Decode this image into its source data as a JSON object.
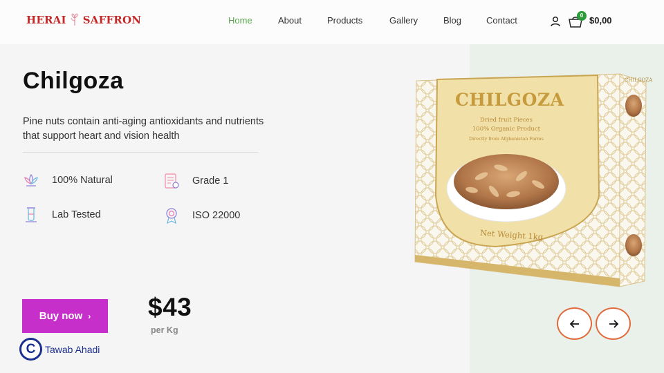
{
  "brand": {
    "logo_left": "HERAI",
    "logo_right": "SAFFRON",
    "logo_color": "#c62828"
  },
  "nav": {
    "items": [
      {
        "label": "Home",
        "active": true
      },
      {
        "label": "About",
        "active": false
      },
      {
        "label": "Products",
        "active": false
      },
      {
        "label": "Gallery",
        "active": false
      },
      {
        "label": "Blog",
        "active": false
      },
      {
        "label": "Contact",
        "active": false
      }
    ]
  },
  "header_actions": {
    "user_icon": "user-icon",
    "cart_icon": "cart-icon",
    "cart_count": "0",
    "cart_total": "$0,00"
  },
  "hero": {
    "title": "Chilgoza",
    "description": "Pine nuts contain anti-aging antioxidants and nutrients that support heart and vision health",
    "features": [
      {
        "label": "100% Natural",
        "icon": "lotus-icon"
      },
      {
        "label": "Grade 1",
        "icon": "certificate-icon"
      },
      {
        "label": "Lab Tested",
        "icon": "test-tube-icon"
      },
      {
        "label": "ISO 22000",
        "icon": "award-badge-icon"
      }
    ],
    "buy_label": "Buy now",
    "price": "$43",
    "price_unit": "per Kg"
  },
  "product_box": {
    "title": "CHILGOZA",
    "line1": "Dried fruit Pieces",
    "line2": "100% Organic Product",
    "line3": "Directly from Afghanistan Farms",
    "weight": "Net Weight 1kg",
    "side_label": "CHILGOZA"
  },
  "carousel": {
    "prev_icon": "arrow-left-icon",
    "next_icon": "arrow-right-icon"
  },
  "copyright": {
    "symbol": "C",
    "name": "Tawab Ahadi"
  },
  "colors": {
    "accent_green": "#5aa64f",
    "buy_button": "#c62fc9",
    "carousel_border": "#e06a3a",
    "copyright_blue": "#1b2f8f"
  }
}
